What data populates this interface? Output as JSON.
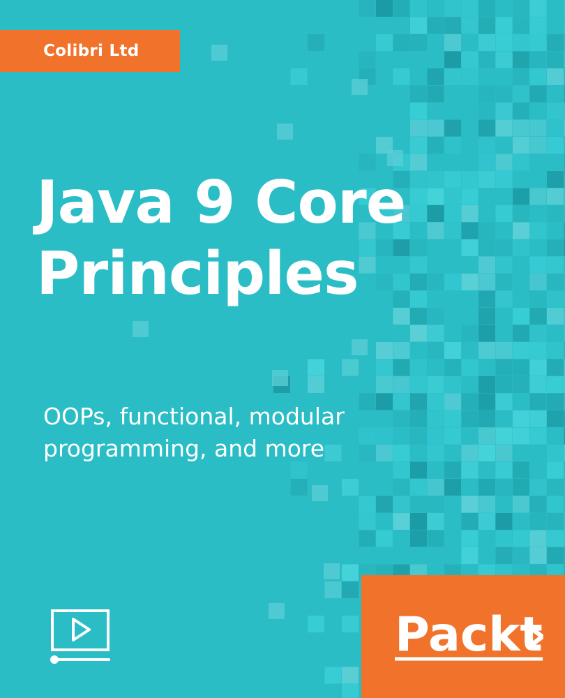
{
  "cover": {
    "background_color": "#2bbdc6",
    "accent_color": "#f1722a",
    "author": "Colibri Ltd",
    "title_lines": [
      "Java 9 Core",
      "Principles"
    ],
    "subtitle_lines": [
      "OOPs, functional, modular",
      "programming, and more"
    ],
    "format_icon": "video-play-icon",
    "publisher": "Packt",
    "publisher_mark": "›"
  }
}
